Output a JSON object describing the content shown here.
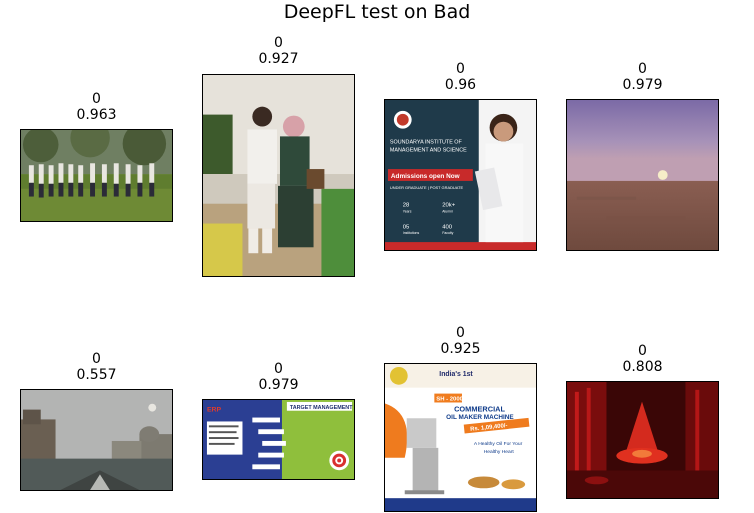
{
  "figure": {
    "title": "DeepFL test on Bad"
  },
  "panels": [
    {
      "label": "0",
      "score": "0.963",
      "subject": "group-photo"
    },
    {
      "label": "0",
      "score": "0.927",
      "subject": "couple-photo"
    },
    {
      "label": "0",
      "score": "0.96",
      "subject": "admissions-ad",
      "text": {
        "line1": "SOUNDARYA INSTITUTE OF",
        "line2": "MANAGEMENT AND SCIENCE",
        "banner": "Admissions open Now",
        "sub": "UNDER GRADUATE | POST GRADUATE",
        "s1": "28",
        "s1l": "Years",
        "s2": "20k+",
        "s2l": "Alumni",
        "s3": "05",
        "s3l": "Institutions",
        "s4": "400",
        "s4l": "Faculty"
      }
    },
    {
      "label": "0",
      "score": "0.979",
      "subject": "desert-moon"
    },
    {
      "label": "0",
      "score": "0.557",
      "subject": "canal-city"
    },
    {
      "label": "0",
      "score": "0.979",
      "subject": "target-management",
      "text": {
        "heading": "TARGET MANAGEMENT",
        "logo": "ERP"
      }
    },
    {
      "label": "0",
      "score": "0.925",
      "subject": "oil-machine-ad",
      "text": {
        "tag": "India's 1st",
        "model": "SH - 2000",
        "headline1": "COMMERCIAL",
        "headline2": "OIL MAKER MACHINE",
        "price": "Rs. 1,09,400/-",
        "tagline1": "A Healthy Oil For Your",
        "tagline2": "Healthy Heart"
      }
    },
    {
      "label": "0",
      "score": "0.808",
      "subject": "red-room"
    }
  ]
}
